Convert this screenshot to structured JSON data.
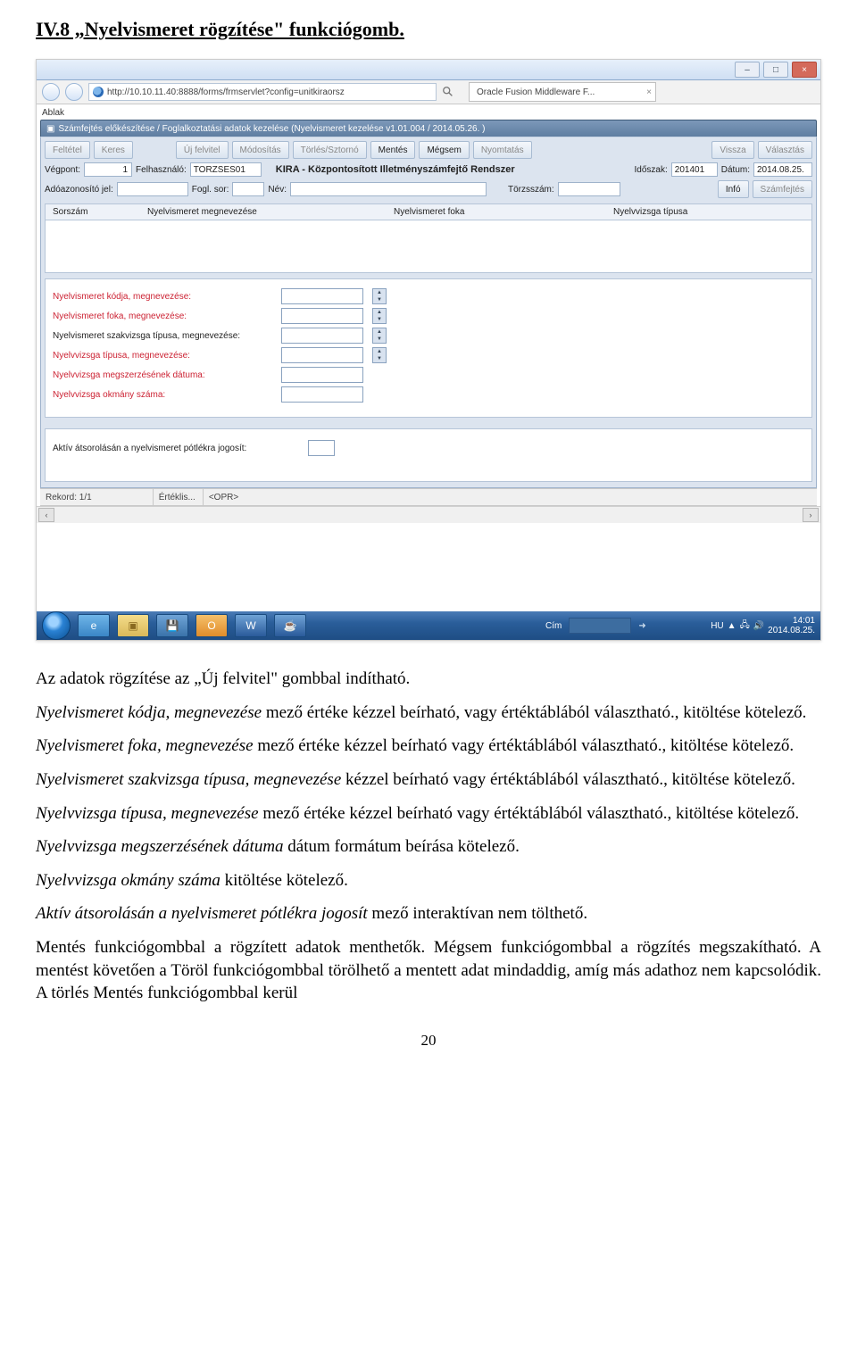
{
  "heading": "IV.8 „Nyelvismeret rögzítése\" funkciógomb.",
  "win": {
    "url": "http://10.10.11.40:8888/forms/frmservlet?config=unitkiraorsz",
    "tab": "Oracle Fusion Middleware F...",
    "min": "–",
    "max": "□",
    "close": "×"
  },
  "ora": {
    "menu": "Ablak",
    "title": "Számfejtés előkészítése / Foglalkoztatási adatok kezelése (Nyelvismeret kezelése v1.01.004 / 2014.05.26. )",
    "btns": {
      "feltetel": "Feltétel",
      "keres": "Keres",
      "ujfelv": "Új felvitel",
      "modositas": "Módosítás",
      "torles": "Törlés/Sztornó",
      "mentes": "Mentés",
      "megsem": "Mégsem",
      "nyomtatas": "Nyomtatás",
      "vissza": "Vissza",
      "valasztas": "Választás",
      "info": "Infó",
      "szamfejtes": "Számfejtés"
    },
    "row1": {
      "vegpont_l": "Végpont:",
      "vegpont_v": "1",
      "felh_l": "Felhasználó:",
      "felh_v": "TORZSES01",
      "kira": "KIRA - Központosított Illetményszámfejtő Rendszer",
      "idoszak_l": "Időszak:",
      "idoszak_v": "201401",
      "datum_l": "Dátum:",
      "datum_v": "2014.08.25."
    },
    "row2": {
      "ado_l": "Adóazonosító jel:",
      "fogl_l": "Fogl. sor:",
      "nev_l": "Név:",
      "torzs_l": "Törzsszám:"
    },
    "cols": {
      "c1": "Sorszám",
      "c2": "Nyelvismeret megnevezése",
      "c3": "Nyelvismeret foka",
      "c4": "Nyelvvizsga típusa"
    },
    "det": {
      "r1": "Nyelvismeret kódja, megnevezése:",
      "r2": "Nyelvismeret foka, megnevezése:",
      "r3": "Nyelvismeret szakvizsga típusa, megnevezése:",
      "r4": "Nyelvvizsga típusa, megnevezése:",
      "r5": "Nyelvvizsga megszerzésének dátuma:",
      "r6": "Nyelvvizsga okmány száma:"
    },
    "foot": "Aktív átsorolásán a nyelvismeret pótlékra jogosít:",
    "status": {
      "rec": "Rekord: 1/1",
      "ert": "Értéklis...",
      "opr": "<OPR>"
    },
    "task": {
      "cim": "Cím",
      "lang": "HU",
      "time": "14:01",
      "date": "2014.08.25."
    }
  },
  "body": {
    "p1": "Az adatok rögzítése az „Új felvitel\" gombbal indítható.",
    "p2a": "Nyelvismeret kódja, megnevezése",
    "p2b": " mező értéke kézzel beírható, vagy értéktáblából választható., kitöltése kötelező.",
    "p3a": "Nyelvismeret foka, megnevezése",
    "p3b": " mező értéke kézzel beírható vagy értéktáblából választható., kitöltése kötelező.",
    "p4a": "Nyelvismeret szakvizsga típusa, megnevezése",
    "p4b": " kézzel beírható vagy értéktáblából választható., kitöltése kötelező.",
    "p5a": "Nyelvvizsga típusa, megnevezése",
    "p5b": " mező értéke kézzel beírható vagy értéktáblából választható., kitöltése kötelező.",
    "p6a": "Nyelvvizsga megszerzésének dátuma",
    "p6b": " dátum formátum beírása kötelező.",
    "p7a": "Nyelvvizsga okmány száma",
    "p7b": " kitöltése kötelező.",
    "p8a": "Aktív átsorolásán a nyelvismeret pótlékra jogosít",
    "p8b": " mező interaktívan nem tölthető.",
    "p9": "Mentés funkciógombbal a rögzített adatok menthetők. Mégsem funkciógombbal a rögzítés megszakítható. A mentést követően a Töröl funkciógombbal törölhető a mentett adat mindaddig, amíg más adathoz nem kapcsolódik. A törlés Mentés funkciógombbal kerül",
    "pagenum": "20"
  }
}
